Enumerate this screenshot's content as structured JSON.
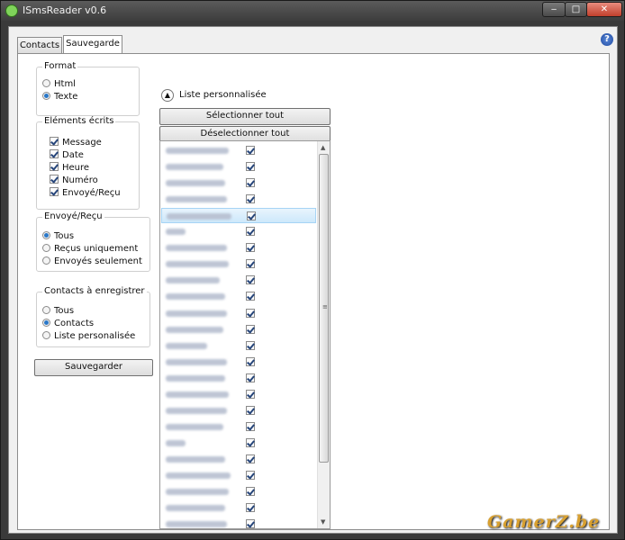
{
  "window": {
    "title": "ISmsReader v0.6",
    "min": "‒",
    "max": "□",
    "close": "✕"
  },
  "tabs": [
    {
      "label": "Contacts"
    },
    {
      "label": "Sauvegarde"
    }
  ],
  "help_glyph": "?",
  "format": {
    "title": "Format",
    "options": [
      "Html",
      "Texte"
    ],
    "selected": "Texte"
  },
  "elements": {
    "title": "Eléments écrits",
    "items": [
      "Message",
      "Date",
      "Heure",
      "Numéro",
      "Envoyé/Reçu"
    ],
    "checked": [
      true,
      true,
      true,
      true,
      true
    ]
  },
  "direction": {
    "title": "Envoyé/Reçu",
    "options": [
      "Tous",
      "Reçus uniquement",
      "Envoyés seulement"
    ],
    "selected": "Tous"
  },
  "contacts_save": {
    "title": "Contacts à enregistrer",
    "options": [
      "Tous",
      "Contacts",
      "Liste personalisée"
    ],
    "selected": "Contacts"
  },
  "save_button": "Sauvegarder",
  "custom_list": {
    "expander_label": "Liste personnalisée",
    "select_all": "Sélectionner tout",
    "deselect_all": "Déselectionner tout",
    "selected_row": 4,
    "rows": 24
  },
  "watermark": "GamerZ.be"
}
